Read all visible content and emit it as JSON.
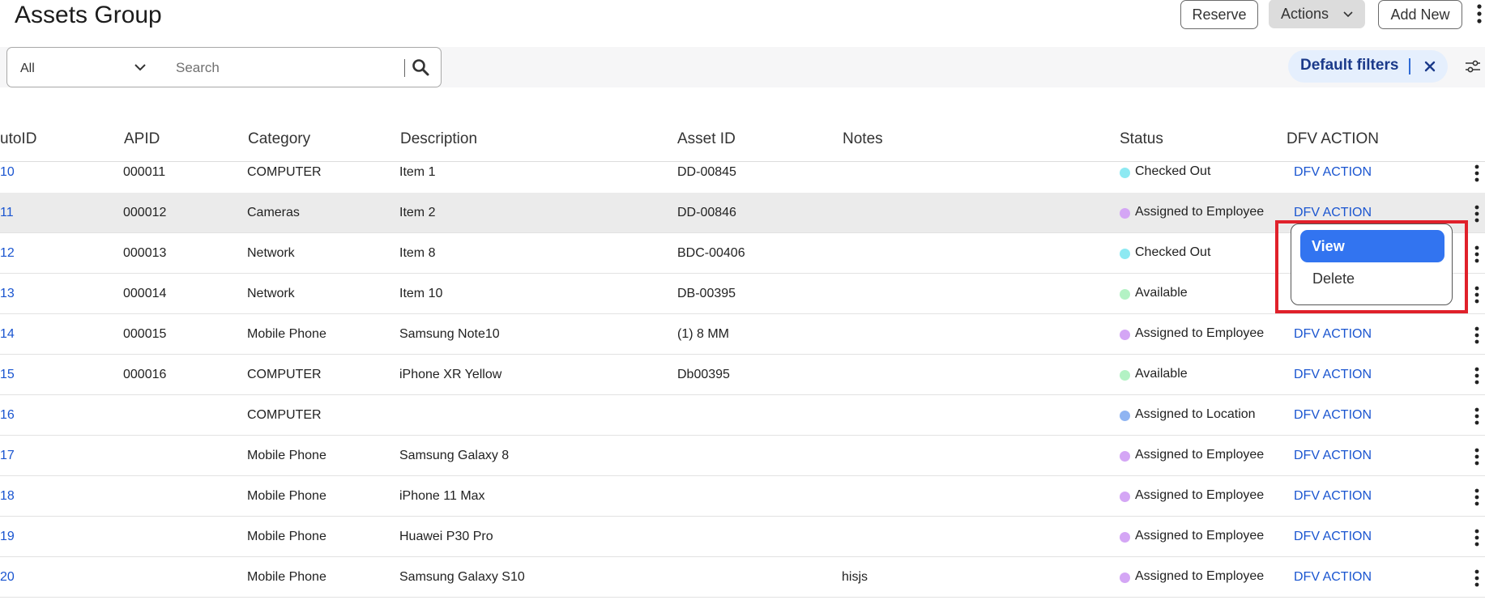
{
  "page": {
    "title": "Assets Group"
  },
  "toolbar": {
    "reserve_label": "Reserve",
    "actions_label": "Actions",
    "add_new_label": "Add New"
  },
  "filters": {
    "select_value": "All",
    "search_placeholder": "Search",
    "default_filters_label": "Default filters"
  },
  "table": {
    "columns": [
      "utoID",
      "APID",
      "Category",
      "Description",
      "Asset ID",
      "Notes",
      "Status",
      "DFV ACTION"
    ],
    "rows": [
      {
        "autoid": "10",
        "apid": "000011",
        "category": "COMPUTER",
        "description": "Item 1",
        "asset_id": "DD-00845",
        "notes": "",
        "status": "Checked Out",
        "status_color": "#8de9f2",
        "action": "DFV ACTION"
      },
      {
        "autoid": "11",
        "apid": "000012",
        "category": "Cameras",
        "description": "Item 2",
        "asset_id": "DD-00846",
        "notes": "",
        "status": "Assigned to Employee",
        "status_color": "#d4a6f5",
        "action": "DFV ACTION"
      },
      {
        "autoid": "12",
        "apid": "000013",
        "category": "Network",
        "description": "Item 8",
        "asset_id": "BDC-00406",
        "notes": "",
        "status": "Checked Out",
        "status_color": "#8de9f2",
        "action": ""
      },
      {
        "autoid": "13",
        "apid": "000014",
        "category": "Network",
        "description": "Item 10",
        "asset_id": "DB-00395",
        "notes": "",
        "status": "Available",
        "status_color": "#b3f2c4",
        "action": ""
      },
      {
        "autoid": "14",
        "apid": "000015",
        "category": "Mobile Phone",
        "description": "Samsung Note10",
        "asset_id": "(1) 8 MM",
        "notes": "",
        "status": "Assigned to Employee",
        "status_color": "#d4a6f5",
        "action": "DFV ACTION"
      },
      {
        "autoid": "15",
        "apid": "000016",
        "category": "COMPUTER",
        "description": "iPhone XR Yellow",
        "asset_id": "Db00395",
        "notes": "",
        "status": "Available",
        "status_color": "#b3f2c4",
        "action": "DFV ACTION"
      },
      {
        "autoid": "16",
        "apid": "",
        "category": "COMPUTER",
        "description": "",
        "asset_id": "",
        "notes": "",
        "status": "Assigned to Location",
        "status_color": "#8fb4f2",
        "action": "DFV ACTION"
      },
      {
        "autoid": "17",
        "apid": "",
        "category": "Mobile Phone",
        "description": "Samsung Galaxy 8",
        "asset_id": "",
        "notes": "",
        "status": "Assigned to Employee",
        "status_color": "#d4a6f5",
        "action": "DFV ACTION"
      },
      {
        "autoid": "18",
        "apid": "",
        "category": "Mobile Phone",
        "description": "iPhone 11 Max",
        "asset_id": "",
        "notes": "",
        "status": "Assigned to Employee",
        "status_color": "#d4a6f5",
        "action": "DFV ACTION"
      },
      {
        "autoid": "19",
        "apid": "",
        "category": "Mobile Phone",
        "description": "Huawei P30 Pro",
        "asset_id": "",
        "notes": "",
        "status": "Assigned to Employee",
        "status_color": "#d4a6f5",
        "action": "DFV ACTION"
      },
      {
        "autoid": "20",
        "apid": "",
        "category": "Mobile Phone",
        "description": "Samsung Galaxy S10",
        "asset_id": "",
        "notes": "hisjs",
        "status": "Assigned to Employee",
        "status_color": "#d4a6f5",
        "action": "DFV ACTION"
      }
    ]
  },
  "row_menu": {
    "view_label": "View",
    "delete_label": "Delete"
  },
  "colors": {
    "link": "#1a55d0",
    "primary": "#3274f0",
    "highlight_outline": "#e0212b",
    "chip_bg": "#e5effd"
  }
}
